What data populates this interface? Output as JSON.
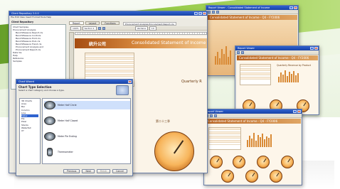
{
  "main_window": {
    "title": "Client Repository 2.0.0",
    "menu": "File  Edit  View  Insert  Format  Tools  Help",
    "tabs": [
      "Report",
      "Layout",
      "Functions"
    ],
    "path": "Procurement Analysis Procurement Report.cls",
    "zoom": "100%",
    "section": "Section 1",
    "font": "Verdana",
    "font_size": "10",
    "repo_label": "Client Repository",
    "tree": [
      "Chart Samples",
      "Procurement Analysis",
      "BenchMeasure Report.cls",
      "BenchMeasure Controls",
      "BenchMeasure Hold.cls",
      "BenchMeasure Pool.cls",
      "BenchMeasure Trend.cls",
      "Procurement Analysis and",
      "Procurement Report.cls",
      "Data Vis",
      "Help",
      "Reference",
      "Samples"
    ]
  },
  "main_report": {
    "company_title": "統升公司",
    "statement_title": "Consolidated Statement of Income",
    "quarterly_label": "Quarterly R",
    "gauge_label": "第二十三季"
  },
  "dialog": {
    "title": "Chart Wizard",
    "heading": "Chart Type Selection",
    "subheading": "Select a chart category and choose a type.",
    "categories": [
      "3D Charts",
      "Area",
      "Bar",
      "Column",
      "Line",
      "Meter",
      "Pie",
      "Polar",
      "Stacks",
      "Waterfall",
      "XY"
    ],
    "selected_category": "Meter",
    "options": [
      "Meter Half Circle",
      "Meter Half Closed",
      "Meter Pie Ending",
      "Thermometer"
    ],
    "buttons": [
      "Previous",
      "Next",
      "Finish",
      "Cancel"
    ]
  },
  "back_window": {
    "title": "Report Viewer - Consolidated Statement of Income",
    "header": "Consolidated Statement of Income - Q4 - FY2006"
  },
  "mid_window": {
    "title": "Report Viewer",
    "header": "Consolidated Statement of Income - Q4 - FY2006",
    "chart_label": "Quarterly Revenue by Product"
  },
  "front_window": {
    "title": "Report Viewer",
    "header": "Consolidated Statement of Income - Q4 - FY2006"
  }
}
